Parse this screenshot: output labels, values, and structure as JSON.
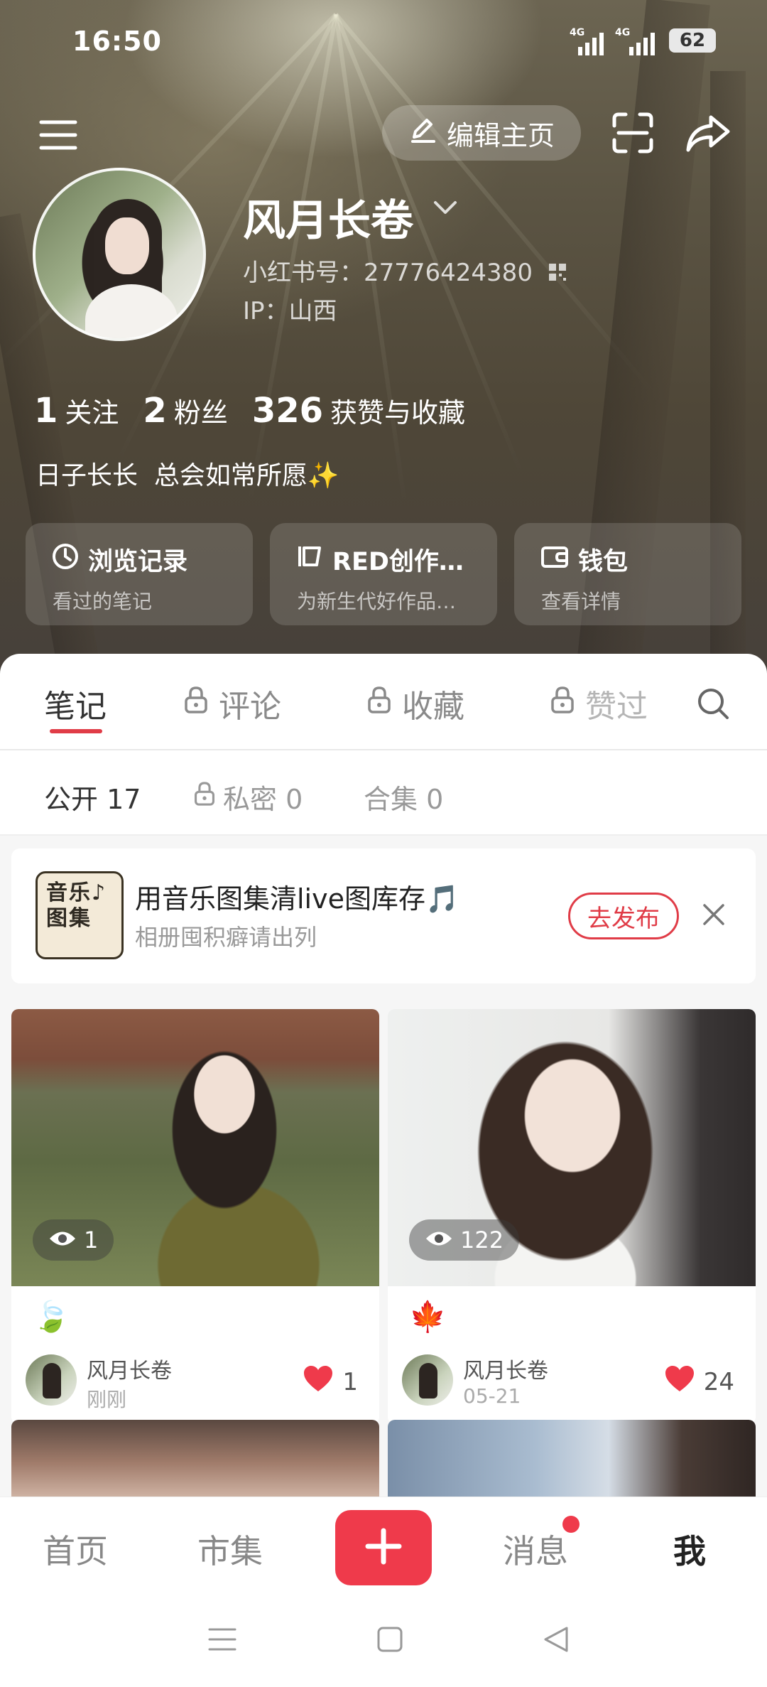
{
  "status_bar": {
    "time": "16:50",
    "signal1_label": "4G",
    "signal2_label": "4G",
    "battery": "62"
  },
  "top_bar": {
    "edit_profile_label": "编辑主页"
  },
  "profile": {
    "name": "风月长卷",
    "id_text": "小红书号：27776424380",
    "ip_text": "IP：山西",
    "stats": [
      {
        "num": "1",
        "label": "关注"
      },
      {
        "num": "2",
        "label": "粉丝"
      },
      {
        "num": "326",
        "label": "获赞与收藏"
      }
    ],
    "bio": "日子长长  总会如常所愿✨"
  },
  "quick_cards": [
    {
      "title": "浏览记录",
      "sub": "看过的笔记",
      "icon": "clock-icon"
    },
    {
      "title": "RED创作…",
      "sub": "为新生代好作品…",
      "icon": "creator-icon"
    },
    {
      "title": "钱包",
      "sub": "查看详情",
      "icon": "wallet-icon"
    }
  ],
  "tabs": [
    {
      "label": "笔记"
    },
    {
      "label": "评论"
    },
    {
      "label": "收藏"
    },
    {
      "label": "赞过"
    }
  ],
  "subtabs": [
    {
      "label": "公开 17"
    },
    {
      "label": "私密 0"
    },
    {
      "label": "合集 0"
    }
  ],
  "banner": {
    "icon_text": "音乐♪图集",
    "title": "用音乐图集清live图库存🎵",
    "subtitle": "相册囤积癖请出列",
    "button": "去发布"
  },
  "posts": [
    {
      "views": "1",
      "emoji": "🍃",
      "author": "风月长卷",
      "time": "刚刚",
      "likes": "1"
    },
    {
      "views": "122",
      "emoji": "🍁",
      "author": "风月长卷",
      "time": "05-21",
      "likes": "24"
    }
  ],
  "bottom_nav": [
    {
      "label": "首页"
    },
    {
      "label": "市集"
    },
    {
      "label": "消息"
    },
    {
      "label": "我"
    }
  ],
  "colors": {
    "accent": "#ef3a4b",
    "tab_underline": "#e03c47"
  }
}
